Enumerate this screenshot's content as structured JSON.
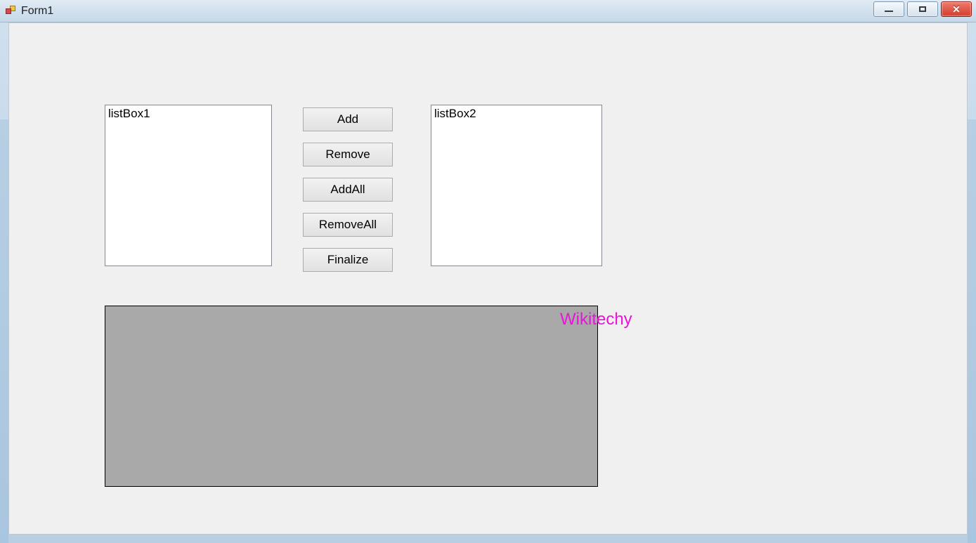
{
  "window": {
    "title": "Form1"
  },
  "listbox1": {
    "label": "listBox1"
  },
  "listbox2": {
    "label": "listBox2"
  },
  "buttons": {
    "add": "Add",
    "remove": "Remove",
    "addall": "AddAll",
    "removeall": "RemoveAll",
    "finalize": "Finalize"
  },
  "watermark": {
    "text": "Wikitechy"
  }
}
